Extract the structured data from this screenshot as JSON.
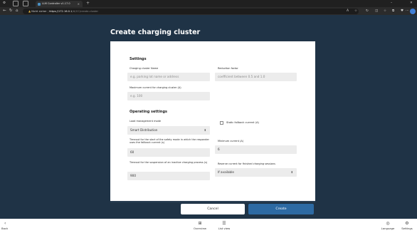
{
  "browser": {
    "tab_title": "LLM Controller v1.17.0",
    "new_tab": "+",
    "address_warning": "Nicht sicher",
    "address_host": "https://172.16.0.1",
    "address_path": "/#/CC/create-cluster"
  },
  "page": {
    "title": "Create charging cluster"
  },
  "settings": {
    "title": "Settings",
    "name_label": "Charging cluster Name",
    "name_placeholder": "e.g. parking lot name or address",
    "reduction_label": "Reduction factor",
    "reduction_placeholder": "coefficient between 0.5 and 1.0",
    "max_current_label": "Maximum current for charging cluster (A)",
    "max_current_placeholder": "e.g. 100"
  },
  "operating": {
    "title": "Operating settings",
    "lm_mode_label": "Load management mode",
    "lm_mode_value": "Smart Distribution",
    "static_fallback_label": "Static fallback current (A)",
    "safety_timeout_label": "Timeout for the start of the safety mode in which the responder uses the fallback current (s)",
    "safety_timeout_value": "60",
    "min_current_label": "Minimum current (A)",
    "min_current_value": "6",
    "suspension_timeout_label": "Timeout for the suspension of an inactive charging process (s)",
    "suspension_timeout_value": "900",
    "reserve_label": "Reserve current for finished charging sessions",
    "reserve_value": "If available"
  },
  "actions": {
    "cancel": "Cancel",
    "create": "Create"
  },
  "bottom": {
    "back": "Back",
    "overview": "Overview",
    "list_view": "List view",
    "language": "Language",
    "settings": "Settings"
  },
  "colors": {
    "background": "#1f3346",
    "primary": "#2d6aa3"
  }
}
